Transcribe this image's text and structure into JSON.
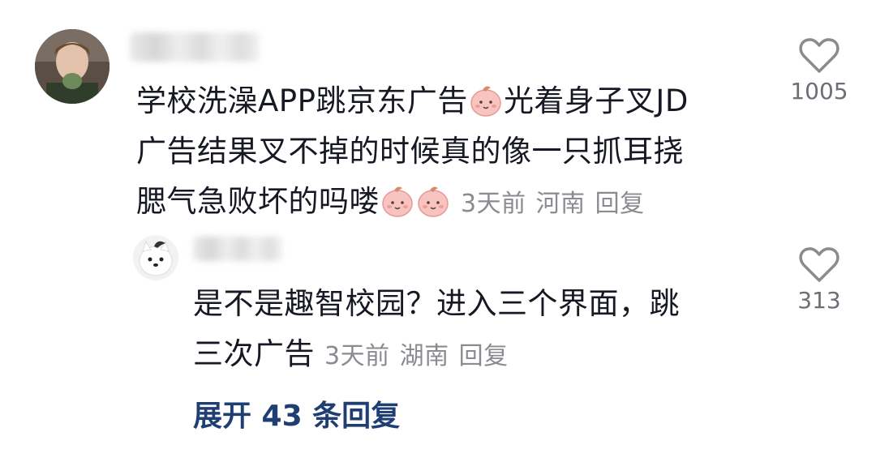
{
  "comment": {
    "text_line1": "学校洗澡APP跳京东广告",
    "text_line1b": "光着身子叉JD",
    "text_line2": "广告结果叉不掉的时候真的像一只抓耳挠",
    "text_line3": "腮气急败坏的吗喽",
    "time": "3天前",
    "location": "河南",
    "reply_label": "回复",
    "like_count": "1005",
    "emojis": [
      "peach-face-emoji",
      "peach-face-emoji",
      "peach-face-emoji"
    ]
  },
  "reply": {
    "text_line1": "是不是趣智校园？进入三个界面，跳",
    "text_line2": "三次广告",
    "time": "3天前",
    "location": "湖南",
    "reply_label": "回复",
    "like_count": "313"
  },
  "expand_label": "展开 43 条回复",
  "icons": [
    "heart-outline-icon",
    "heart-outline-icon"
  ],
  "colors": {
    "text": "#161823",
    "meta": "#8a8b91",
    "link": "#1f3f72",
    "emoji": "#f5b9b6"
  }
}
